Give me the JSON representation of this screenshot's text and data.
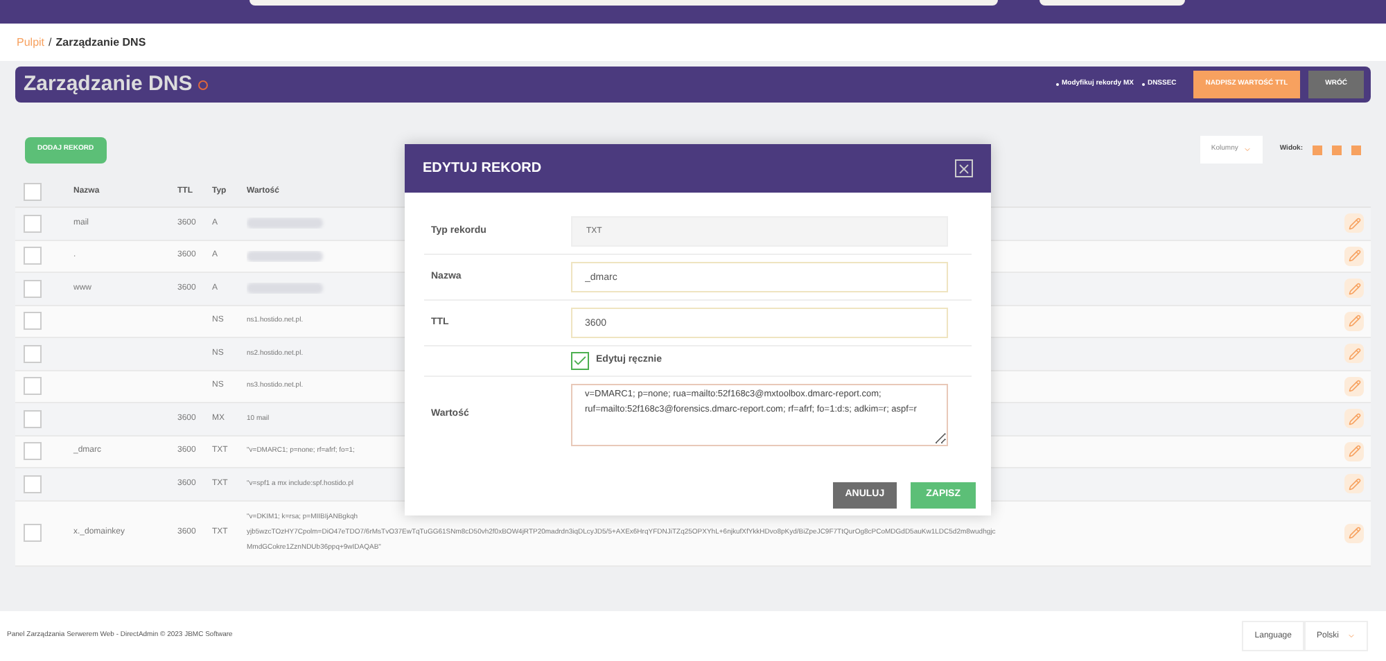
{
  "breadcrumb": {
    "link": "Pulpit",
    "separator": "/",
    "current": "Zarządzanie DNS"
  },
  "title_bar": {
    "title": "Zarządzanie DNS",
    "links": [
      "Modyfikuj rekordy MX",
      "DNSSEC"
    ],
    "buttons": [
      {
        "label": "NADPISZ WARTOŚĆ TTL",
        "kind": "primary"
      },
      {
        "label": "WRÓĆ",
        "kind": "secondary"
      }
    ]
  },
  "toolbar": {
    "add_button": "DODAJ REKORD",
    "columns_dropdown": "Kolumny",
    "view_label": "Widok:",
    "view_options": [
      {
        "selected": true
      },
      {
        "selected": true
      },
      {
        "selected": true
      }
    ]
  },
  "table": {
    "select_all_checked": false,
    "columns": [
      "Nazwa",
      "TTL",
      "Typ",
      "Wartość"
    ],
    "rows": [
      {
        "checked": false,
        "name": "mail",
        "ttl": "3600",
        "type": "A",
        "value_hidden": true
      },
      {
        "checked": false,
        "name": ".",
        "ttl": "3600",
        "type": "A",
        "value_hidden": true
      },
      {
        "checked": false,
        "name": "www",
        "ttl": "3600",
        "type": "A",
        "value_hidden": true
      },
      {
        "checked": false,
        "type": "NS",
        "value": [
          "ns1.hostido.net.pl."
        ]
      },
      {
        "checked": false,
        "type": "NS",
        "value": [
          "ns2.hostido.net.pl."
        ]
      },
      {
        "checked": false,
        "type": "NS",
        "value": [
          "ns3.hostido.net.pl."
        ]
      },
      {
        "checked": false,
        "ttl": "3600",
        "type": "MX",
        "value": [
          "10 mail"
        ]
      },
      {
        "checked": false,
        "name": "_dmarc",
        "ttl": "3600",
        "type": "TXT",
        "value": [
          "\"v=DMARC1; p=none; rf=afrf; fo=1;"
        ]
      },
      {
        "checked": false,
        "ttl": "3600",
        "type": "TXT",
        "value": [
          "\"v=spf1 a mx include:spf.hostido.pl"
        ]
      },
      {
        "checked": false,
        "name": "x._domainkey",
        "ttl": "3600",
        "type": "TXT",
        "value": [
          "\"v=DKIM1; k=rsa; p=MIIBIjANBgkqh",
          "yjb5wzcTOzHY7Cpolm=DiO47eTDO7/6rMsTvO37EwTqTuGG61SNm8cD50vh2f0xBOW4jRTP20madrdn3iqDLcyJD5/5+AXEx6HrqYFDNJiTZq25OPXYhL+6njkufXfYkkHDvo8pKyd/BiZpeJC9F7TtQurOg8cPCoMDGdD5auKw1LDC5d2m8wudhgjc",
          "MmdGCokre1ZznNDUb36ppq+9wIDAQAB\""
        ]
      }
    ]
  },
  "modal": {
    "title": "EDYTUJ REKORD",
    "fields": [
      {
        "kind": "readonly",
        "label": "Typ rekordu",
        "value": "TXT"
      },
      {
        "kind": "input",
        "label": "Nazwa",
        "value": "_dmarc"
      },
      {
        "kind": "input",
        "label": "TTL",
        "value": "3600"
      },
      {
        "kind": "checkbox",
        "label": "Edytuj ręcznie",
        "checked": true
      },
      {
        "kind": "textarea",
        "label": "Wartość",
        "value": "v=DMARC1; p=none; rua=mailto:52f168c3@mxtoolbox.dmarc-report.com; ruf=mailto:52f168c3@forensics.dmarc-report.com; rf=afrf; fo=1:d:s; adkim=r; aspf=r"
      }
    ],
    "buttons": [
      {
        "label": "ANULUJ",
        "kind": "secondary"
      },
      {
        "label": "ZAPISZ",
        "kind": "primary"
      }
    ]
  },
  "footer": {
    "text": "Panel Zarządzania Serwerem Web - DirectAdmin © 2023 JBMC Software",
    "language_button": "Language",
    "language_select": "Polski"
  }
}
